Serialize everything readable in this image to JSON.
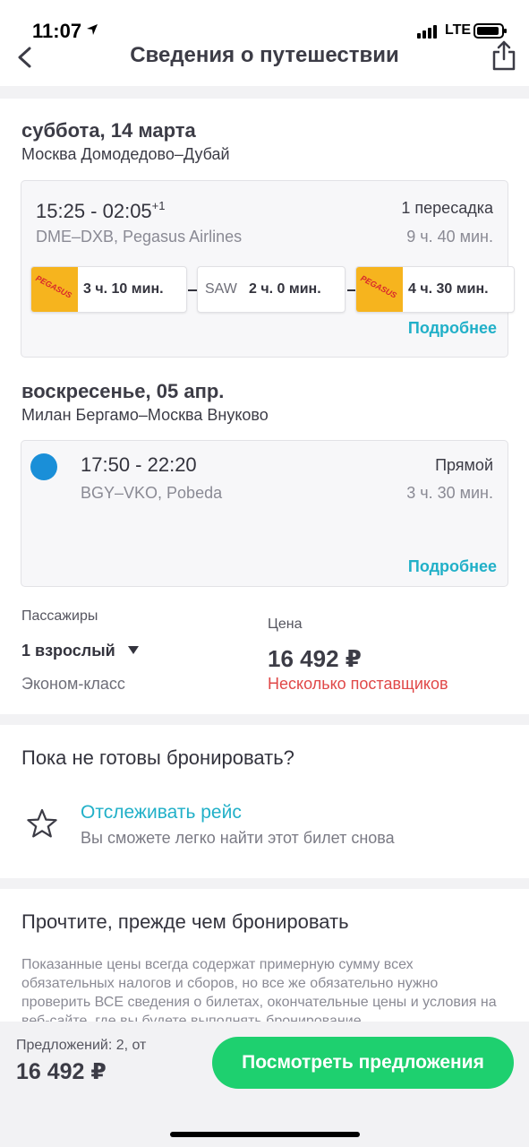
{
  "status": {
    "time": "11:07",
    "network": "LTE"
  },
  "header": {
    "title": "Сведения о путешествии"
  },
  "outbound": {
    "date": "суббота, 14 марта",
    "route": "Москва Домодедово–Дубай",
    "times": "15:25 - 02:05",
    "day_offset": "+1",
    "codes": "DME–DXB, Pegasus Airlines",
    "stops": "1 пересадка",
    "duration": "9 ч. 40 мин.",
    "segments": [
      {
        "airline_logo": "PEGASUS",
        "duration": "3 ч. 10 мин."
      },
      {
        "airport": "SAW",
        "duration": "2 ч. 0 мин."
      },
      {
        "airline_logo": "PEGASUS",
        "duration": "4 ч. 30 мин."
      }
    ],
    "details_link": "Подробнее"
  },
  "return": {
    "date": "воскресенье, 05 апр.",
    "route": "Милан Бергамо–Москва Внуково",
    "times": "17:50 - 22:20",
    "codes": "BGY–VKO, Pobeda",
    "stops": "Прямой",
    "duration": "3 ч. 30 мин.",
    "details_link": "Подробнее"
  },
  "booking": {
    "passengers_label": "Пассажиры",
    "passengers_value": "1 взрослый",
    "cabin_class": "Эконом-класс",
    "price_label": "Цена",
    "price": "16 492 ₽",
    "providers": "Несколько поставщиков"
  },
  "track": {
    "question": "Пока не готовы бронировать?",
    "title": "Отслеживать рейс",
    "subtitle": "Вы сможете легко найти этот билет снова"
  },
  "notice": {
    "title": "Прочтите, прежде чем бронировать",
    "text": "Показанные цены всегда содержат примерную сумму всех обязательных налогов и сборов, но все же обязательно нужно проверить ВСЕ сведения о билетах, окончательные цены и условия на веб-сайте, где вы будете выполнять бронирование."
  },
  "footer": {
    "offers": "Предложений: 2, от",
    "price": "16 492 ₽",
    "cta": "Посмотреть предложения"
  },
  "colors": {
    "accent": "#21b0c8",
    "cta": "#1ed06f",
    "warning": "#e04848",
    "pegasus": "#f6b41e",
    "pobeda": "#1a8fd8"
  }
}
